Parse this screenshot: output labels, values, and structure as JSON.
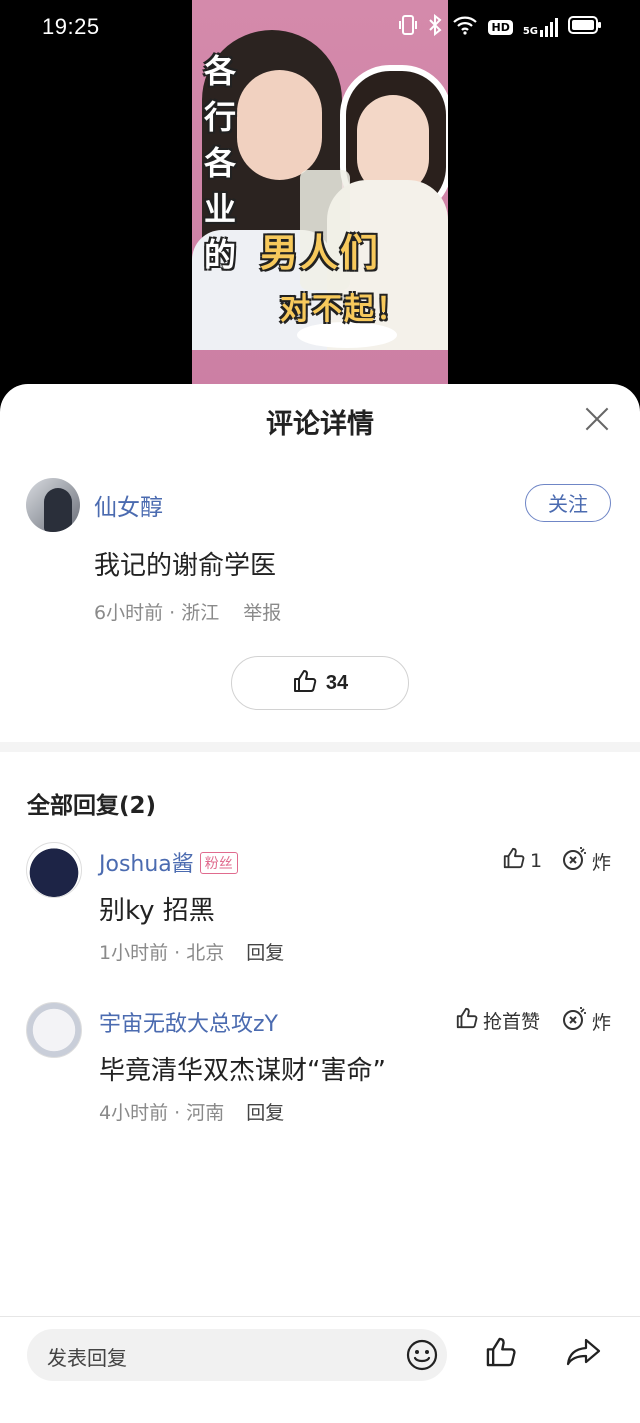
{
  "status_bar": {
    "time": "19:25",
    "network": "5G",
    "hd": "HD"
  },
  "video": {
    "overlay_vertical": "各行各业的",
    "overlay_big": "男人们",
    "overlay_small": "对不起！"
  },
  "sheet": {
    "title": "评论详情",
    "comment": {
      "author": "仙女醇",
      "follow_label": "关注",
      "text": "我记的谢俞学医",
      "time": "6小时前",
      "location": "浙江",
      "report_label": "举报",
      "likes": "34"
    },
    "replies_title": "全部回复(2)",
    "replies": [
      {
        "author": "Joshua酱",
        "badge": "粉丝",
        "text": "别ky 招黑",
        "time": "1小时前",
        "location": "北京",
        "reply_label": "回复",
        "like_label": "1",
        "bomb_label": "炸"
      },
      {
        "author": "宇宙无敌大总攻zY",
        "text": "毕竟清华双杰谋财“害命”",
        "time": "4小时前",
        "location": "河南",
        "reply_label": "回复",
        "like_label": "抢首赞",
        "bomb_label": "炸"
      }
    ],
    "input_placeholder": "发表回复"
  },
  "colors": {
    "link": "#4b6bb0",
    "badge": "#e06b8e",
    "video_bg": "#cf86a8"
  }
}
